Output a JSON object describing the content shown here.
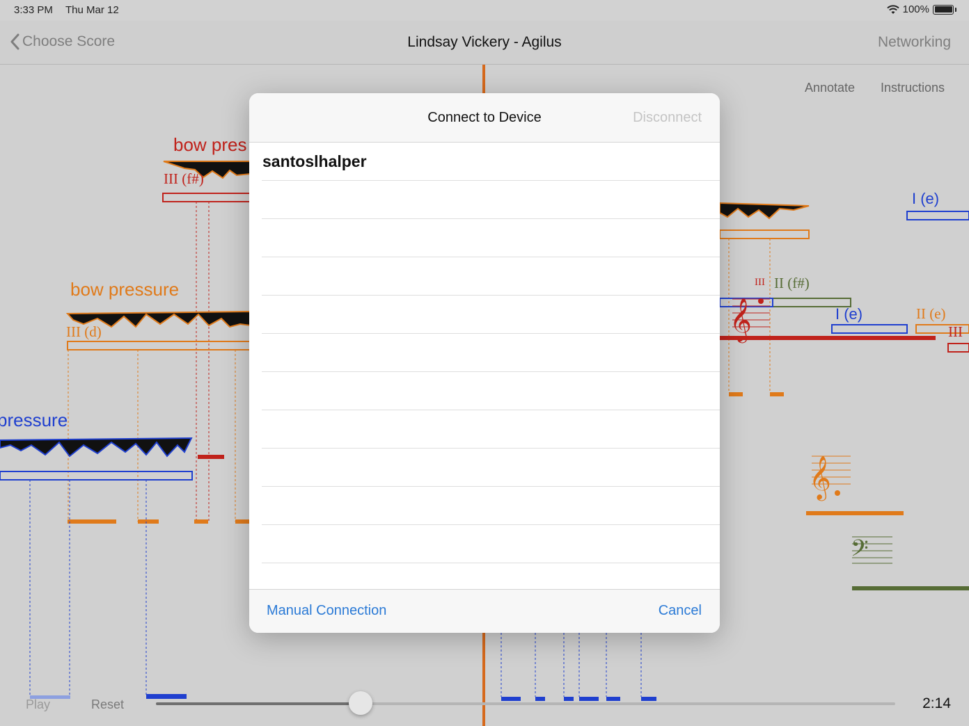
{
  "status": {
    "time": "3:33 PM",
    "date": "Thu Mar 12",
    "battery": "100%"
  },
  "nav": {
    "back_label": "Choose Score",
    "title": "Lindsay Vickery - Agilus",
    "right_label": "Networking"
  },
  "toolbar": {
    "annotate": "Annotate",
    "instructions": "Instructions"
  },
  "score": {
    "labels": {
      "bow_pres": "bow pres",
      "bow_pressure": "bow pressure",
      "pressure": "pressure",
      "iii_fsharp": "III (f#)",
      "iii_d": "III (d)",
      "i_e_top": "I (e)",
      "ii_fsharp": "II (f#)",
      "iii_mark": "III",
      "i_e_mid": "I (e)",
      "ii_e": "II (e)",
      "iii_right": "III"
    },
    "colors": {
      "orange": "#e07a1a",
      "red": "#c0221b",
      "blue": "#1f3fcf",
      "green": "#566c35",
      "playhead": "#d6691c"
    }
  },
  "controls": {
    "play": "Play",
    "reset": "Reset",
    "elapsed": "2:14",
    "progress": 0.277
  },
  "modal": {
    "title": "Connect to Device",
    "disconnect": "Disconnect",
    "devices": [
      "santoslhalper",
      "",
      "",
      "",
      "",
      "",
      "",
      "",
      "",
      "",
      "",
      ""
    ],
    "manual": "Manual Connection",
    "cancel": "Cancel"
  }
}
